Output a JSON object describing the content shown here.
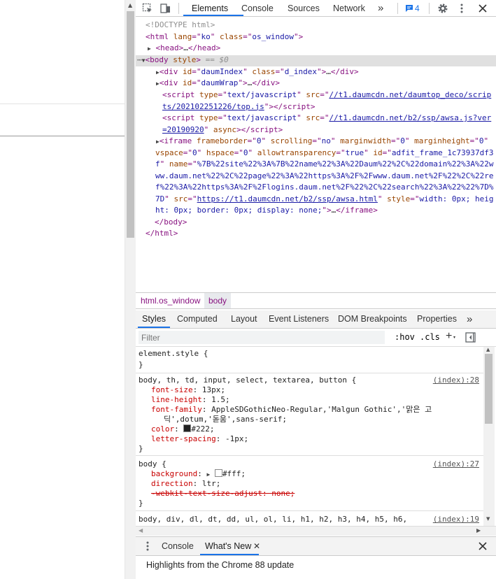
{
  "devtools": {
    "main_tabs": [
      "Elements",
      "Console",
      "Sources",
      "Network"
    ],
    "more_tabs_glyph": "»",
    "issues_count": "4",
    "icons": [
      "inspect-element-icon",
      "device-toolbar-icon",
      "message-icon",
      "gear-icon",
      "kebab-menu-icon",
      "close-icon"
    ]
  },
  "dom": {
    "doctype": "<!DOCTYPE html>",
    "html_lang": "ko",
    "html_class": "os_window",
    "head_collapsed": "…",
    "body_marker": "== $0",
    "div1_id": "daumIndex",
    "div1_class": "d_index",
    "div2_id": "daumWrap",
    "script1_type": "text/javascript",
    "script1_src_a": "//t1.daumcdn.net/daumtop_deco/scrip",
    "script1_src_b": "ts/202102251226/top.js",
    "script2_type": "text/javascript",
    "script2_src_a": "//t1.daumcdn.net/b2/ssp/awsa.js?ver",
    "script2_src_b": "=20190920",
    "iframe_frameborder": "0",
    "iframe_scrolling": "no",
    "iframe_marginwidth": "0",
    "iframe_marginheight": "0",
    "iframe_vspace": "0",
    "iframe_hspace": "0",
    "iframe_allowtransparency": "true",
    "iframe_id": "adfit_frame_1c73937df3",
    "iframe_id_cont": "f",
    "iframe_name_a": "%7B%22site%22%3A%7B%22name%22%3A%22Daum%22%2C%22domain%22%3A%22w",
    "iframe_name_b": "ww.daum.net%22%2C%22page%22%3A%22https%3A%2F%2Fwww.daum.net%2F%22%2C%22re",
    "iframe_name_c": "f%22%3A%22https%3A%2F%2Flogins.daum.net%2F%22%2C%22search%22%3A%22%22%7D%",
    "iframe_name_d": "7D",
    "iframe_src": "https://t1.daumcdn.net/b2/ssp/awsa.html",
    "iframe_style_a": "width: 0px; heig",
    "iframe_style_b": "ht: 0px; border: 0px; display: none;"
  },
  "breadcrumb": [
    "html.os_window",
    "body"
  ],
  "styles_tabs": [
    "Styles",
    "Computed",
    "Layout",
    "Event Listeners",
    "DOM Breakpoints",
    "Properties"
  ],
  "filter": {
    "placeholder": "Filter",
    "hov": ":hov",
    "cls": ".cls"
  },
  "styles": {
    "rule0_selector": "element.style {",
    "rule0_close": "}",
    "rule1_selector": "body, th, td, input, select, textarea, button {",
    "rule1_source": "(index):28",
    "rule1_props": [
      {
        "name": "font-size",
        "value": "13px;"
      },
      {
        "name": "line-height",
        "value": "1.5;"
      },
      {
        "name": "font-family",
        "value": "AppleSDGothicNeo-Regular,'Malgun Gothic','맑은 고"
      },
      {
        "name": "",
        "value": "딕',dotum,'돋움',sans-serif;"
      },
      {
        "name": "color",
        "value": "#222;"
      },
      {
        "name": "letter-spacing",
        "value": "-1px;"
      }
    ],
    "rule1_close": "}",
    "color_swatch": "#222222",
    "rule2_selector": "body {",
    "rule2_source": "(index):27",
    "rule2_props": [
      {
        "name": "background",
        "value": "#fff;"
      },
      {
        "name": "direction",
        "value": "ltr;"
      },
      {
        "name": "-webkit-text-size-adjust",
        "value": "none;"
      }
    ],
    "bg_swatch": "#ffffff",
    "rule2_close": "}",
    "rule3_selector": "body, div, dl, dt, dd, ul, ol, li, h1, h2, h3, h4, h5, h6,",
    "rule3_source": "(index):19"
  },
  "drawer": {
    "tabs": [
      "Console",
      "What's New"
    ],
    "content": "Highlights from the Chrome 88 update"
  }
}
